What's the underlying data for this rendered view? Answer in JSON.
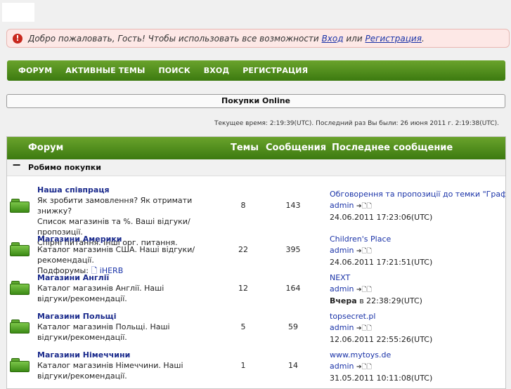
{
  "welcome": {
    "text": "Добро пожаловать, Гость! Чтобы использовать все возможности",
    "login_link": "Вход",
    "or": "или",
    "register_link": "Регистрация",
    "end": "."
  },
  "nav": {
    "items": [
      "ФОРУМ",
      "АКТИВНЫЕ ТЕМЫ",
      "ПОИСК",
      "ВХОД",
      "РЕГИСТРАЦИЯ"
    ]
  },
  "site_title": "Покупки Online",
  "time_info": "Текущее время: 2:19:39(UTC). Последний раз Вы были: 26 июня 2011 г. 2:19:38(UTC).",
  "table": {
    "headers": {
      "forum": "Форум",
      "topics": "Темы",
      "posts": "Сообщения",
      "last": "Последнее сообщение"
    },
    "category": {
      "toggle": "−",
      "title": "Робимо покупки"
    },
    "rows": [
      {
        "name": "Наша співпраця",
        "desc": [
          "Як зробити замовлення? Як отримати знижку?",
          "Список магазинів та %. Ваші відгуки/пропозиції.",
          "Спірні питання. Інші орг. питання."
        ],
        "topics": "8",
        "posts": "143",
        "last_title": "Обговорення та пропозиції до темки \"Графік...",
        "last_author": "admin",
        "last_icons": "➔🗋🗋",
        "last_date_bold": "",
        "last_date": "24.06.2011 17:23:06(UTC)"
      },
      {
        "name": "Магазини Америки",
        "desc": [
          "Каталог магазинів США. Наші відгуки/рекомендації."
        ],
        "subforums_label": "Подфорумы:",
        "subforum": "🗋 iHERB",
        "topics": "22",
        "posts": "395",
        "last_title": "Children's Place",
        "last_author": "admin",
        "last_icons": "➔🗋🗋",
        "last_date_bold": "",
        "last_date": "24.06.2011 17:21:51(UTC)"
      },
      {
        "name": "Магазини Англії",
        "desc": [
          "Каталог магазинів Англії. Наші",
          "відгуки/рекомендації."
        ],
        "topics": "12",
        "posts": "164",
        "last_title": "NEXT",
        "last_author": "admin",
        "last_icons": "➔🗋🗋",
        "last_date_bold": "Вчера",
        "last_date": " в 22:38:29(UTC)"
      },
      {
        "name": "Магазини Польщі",
        "desc": [
          "Каталог магазинів Польщі. Наші",
          "відгуки/рекомендації."
        ],
        "topics": "5",
        "posts": "59",
        "last_title": "topsecret.pl",
        "last_author": "admin",
        "last_icons": "➔🗋🗋",
        "last_date_bold": "",
        "last_date": "12.06.2011 22:55:26(UTC)"
      },
      {
        "name": "Магазини Німеччини",
        "desc": [
          "Каталог магазинів Німеччини. Наші",
          "відгуки/рекомендації."
        ],
        "topics": "1",
        "posts": "14",
        "last_title": "www.mytoys.de",
        "last_author": "admin",
        "last_icons": "➔🗋🗋",
        "last_date_bold": "",
        "last_date": "31.05.2011 10:11:08(UTC)"
      }
    ]
  }
}
